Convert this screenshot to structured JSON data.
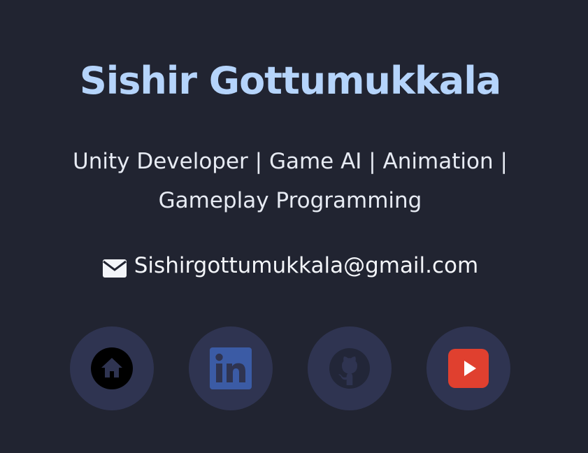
{
  "profile": {
    "name": "Sishir Gottumukkala",
    "tagline_line1": "Unity Developer | Game AI | Animation |",
    "tagline_line2": "Gameplay Programming",
    "email": "Sishirgottumukkala@gmail.com"
  },
  "social_links": [
    {
      "icon": "home-icon"
    },
    {
      "icon": "linkedin-icon"
    },
    {
      "icon": "github-icon"
    },
    {
      "icon": "youtube-icon"
    }
  ],
  "colors": {
    "background": "#212431",
    "name": "#b5d4fb",
    "text": "#e7ebf3",
    "button_background": "#2f3451",
    "linkedin": "#3b5ba5",
    "youtube": "#e0402f"
  }
}
